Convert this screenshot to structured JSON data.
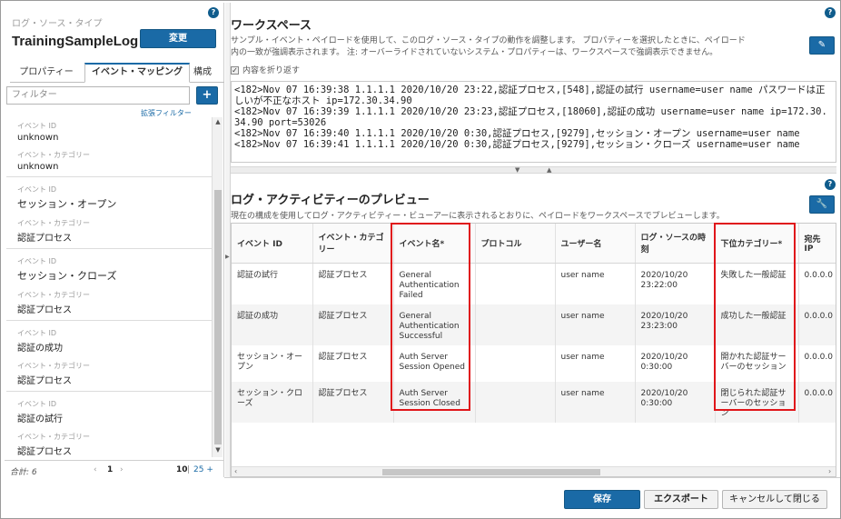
{
  "left_panel": {
    "label": "ログ・ソース・タイプ",
    "name": "TrainingSampleLog",
    "change_button": "変更",
    "tabs": [
      {
        "label": "プロパティー"
      },
      {
        "label": "イベント・マッピング"
      },
      {
        "label": "構成"
      }
    ],
    "filter_placeholder": "フィルター",
    "add_button": "+",
    "advanced_filter": "拡張フィルター",
    "event_id_label": "イベント ID",
    "event_category_label": "イベント・カテゴリー",
    "items": [
      {
        "event_id": "unknown",
        "category": "unknown"
      },
      {
        "event_id": "セッション・オープン",
        "category": "認証プロセス"
      },
      {
        "event_id": "セッション・クローズ",
        "category": "認証プロセス"
      },
      {
        "event_id": "認証の成功",
        "category": "認証プロセス"
      },
      {
        "event_id": "認証の試行",
        "category": "認証プロセス"
      }
    ],
    "pager": {
      "total": "合計: 6",
      "current_page": "1",
      "page_size_a": "10",
      "separator": "|",
      "page_size_b": "25 +"
    }
  },
  "workspace": {
    "title": "ワークスペース",
    "description_1": "サンプル・イベント・ペイロードを使用して、このログ・ソース・タイプの動作を調整します。 プロパティーを選択したときに、ペイロード",
    "description_2": "内の一致が強調表示されます。 注: オーバーライドされていないシステム・プロパティーは、ワークスペースで強調表示できません。",
    "wrap_label": "内容を折り返す",
    "payload_lines": [
      "<182>Nov 07 16:39:38 1.1.1.1 2020/10/20 23:22,認証プロセス,[548],認証の試行 username=user name パスワードは正しいが不正なホスト ip=172.30.34.90",
      "<182>Nov 07 16:39:39 1.1.1.1 2020/10/20 23:23,認証プロセス,[18060],認証の成功 username=user name ip=172.30.34.90 port=53026",
      "<182>Nov 07 16:39:40 1.1.1.1 2020/10/20 0:30,認証プロセス,[9279],セッション・オープン username=user name",
      "<182>Nov 07 16:39:41 1.1.1.1 2020/10/20 0:30,認証プロセス,[9279],セッション・クローズ username=user name"
    ]
  },
  "preview": {
    "title": "ログ・アクティビティーのプレビュー",
    "description": "現在の構成を使用してログ・アクティビティー・ビューアーに表示されるとおりに、ペイロードをワークスペースでプレビューします。",
    "columns": [
      "イベント ID",
      "イベント・カテゴリー",
      "イベント名*",
      "プロトコル",
      "ユーザー名",
      "ログ・ソースの時刻",
      "下位カテゴリー*",
      "宛先 IP"
    ],
    "rows": [
      [
        "認証の試行",
        "認証プロセス",
        "General Authentication Failed",
        "",
        "user name",
        "2020/10/20 23:22:00",
        "失敗した一般認証",
        "0.0.0.0"
      ],
      [
        "認証の成功",
        "認証プロセス",
        "General Authentication Successful",
        "",
        "user name",
        "2020/10/20 23:23:00",
        "成功した一般認証",
        "0.0.0.0"
      ],
      [
        "セッション・オープン",
        "認証プロセス",
        "Auth Server Session Opened",
        "",
        "user name",
        "2020/10/20 0:30:00",
        "開かれた認証サーバーのセッション",
        "0.0.0.0"
      ],
      [
        "セッション・クローズ",
        "認証プロセス",
        "Auth Server Session Closed",
        "",
        "user name",
        "2020/10/20 0:30:00",
        "閉じられた認証サーバーのセッション",
        "0.0.0.0"
      ]
    ]
  },
  "footer": {
    "save": "保存",
    "export": "エクスポート",
    "cancel": "キャンセルして閉じる"
  },
  "colors": {
    "accent": "#1a6aa6",
    "highlight": "#e0161a"
  },
  "icons": {
    "help": "help-icon",
    "edit": "pencil-icon",
    "settings": "wrench-icon"
  }
}
